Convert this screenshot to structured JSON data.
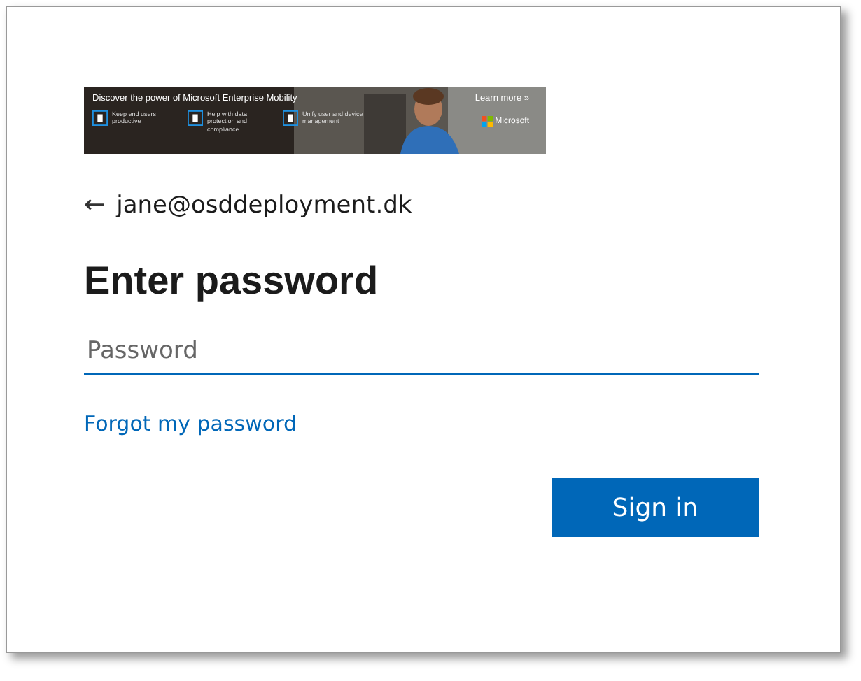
{
  "banner": {
    "headline": "Discover the power of Microsoft Enterprise Mobility",
    "learn_more": "Learn more »",
    "brand": "Microsoft",
    "features": [
      {
        "text": "Keep end users productive"
      },
      {
        "text": "Help with data protection and compliance"
      },
      {
        "text": "Unify user and device management"
      }
    ]
  },
  "identity": {
    "back": "←",
    "email": "jane@osddeployment.dk"
  },
  "title": "Enter password",
  "password": {
    "placeholder": "Password"
  },
  "forgot_link": "Forgot my password",
  "sign_in": "Sign in"
}
